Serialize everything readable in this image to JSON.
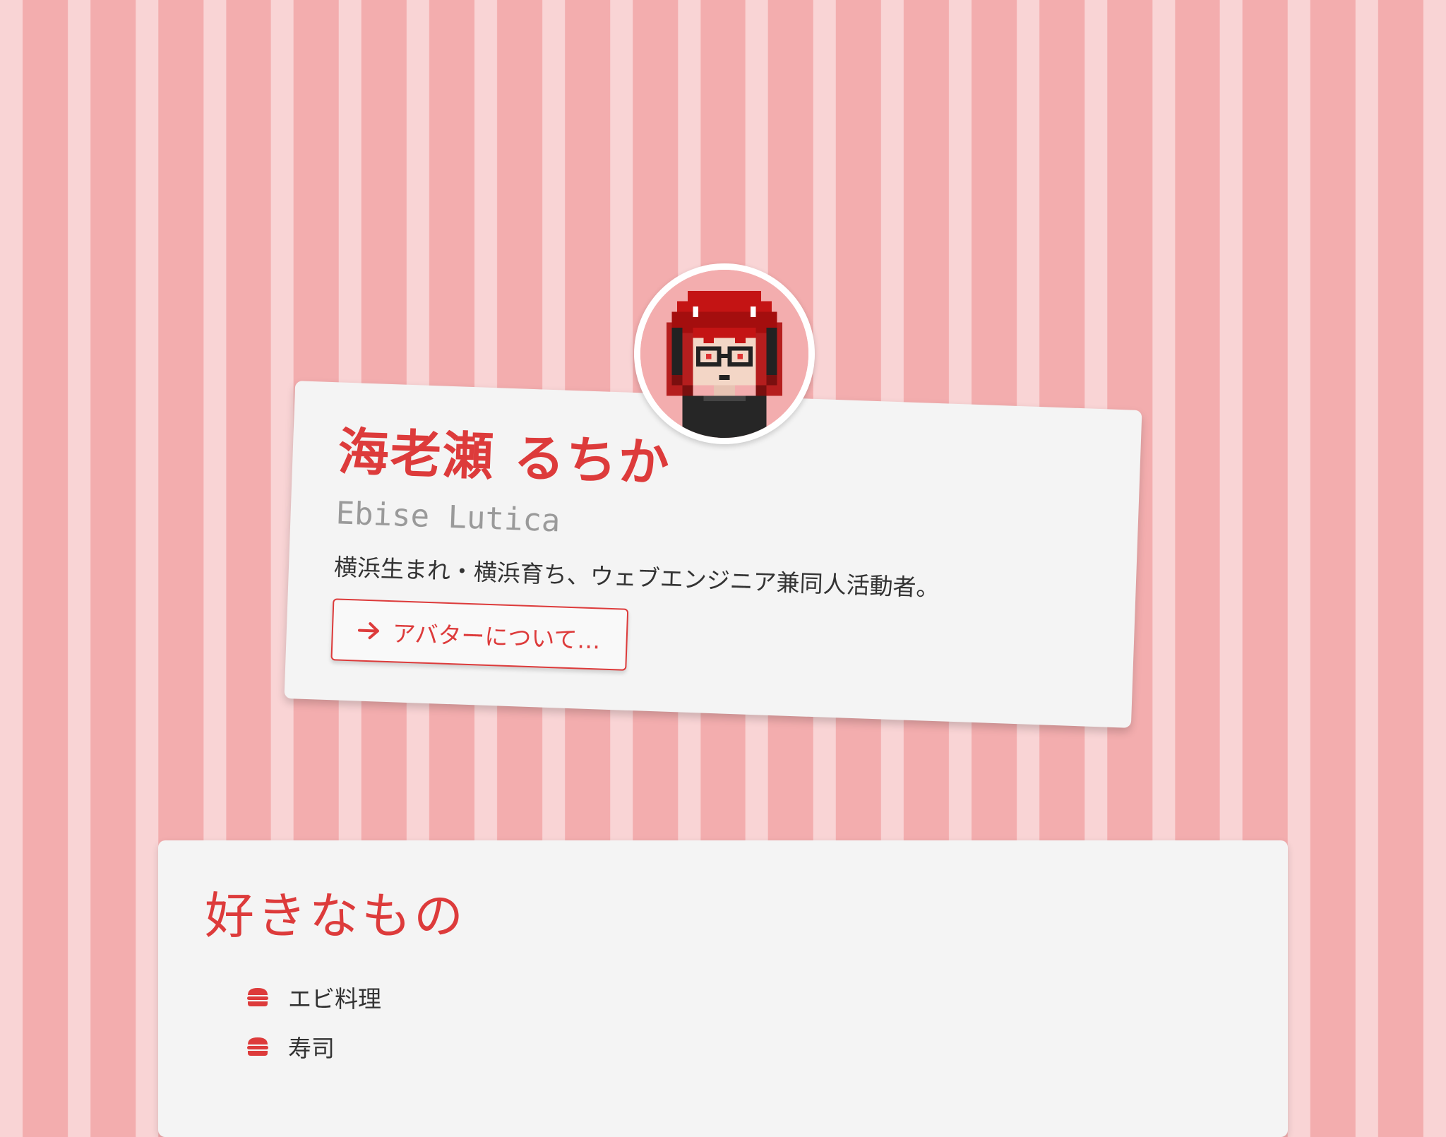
{
  "profile": {
    "name": "海老瀬 るちか",
    "roman_name": "Ebise Lutica",
    "bio": "横浜生まれ・横浜育ち、ウェブエンジニア兼同人活動者。",
    "avatar_button_label": "アバターについて…",
    "avatar_button_icon": "arrow-right-icon",
    "avatar_icon": "pixel-avatar-icon"
  },
  "favorites": {
    "title": "好きなもの",
    "item_icon": "burger-icon",
    "items": [
      {
        "label": "エビ料理"
      },
      {
        "label": "寿司"
      }
    ]
  },
  "colors": {
    "accent": "#dd3b3b",
    "stripe_light": "#f9d4d5",
    "stripe_dark": "#f3adae",
    "card": "#f4f4f4",
    "muted_text": "#9a9a9a"
  }
}
